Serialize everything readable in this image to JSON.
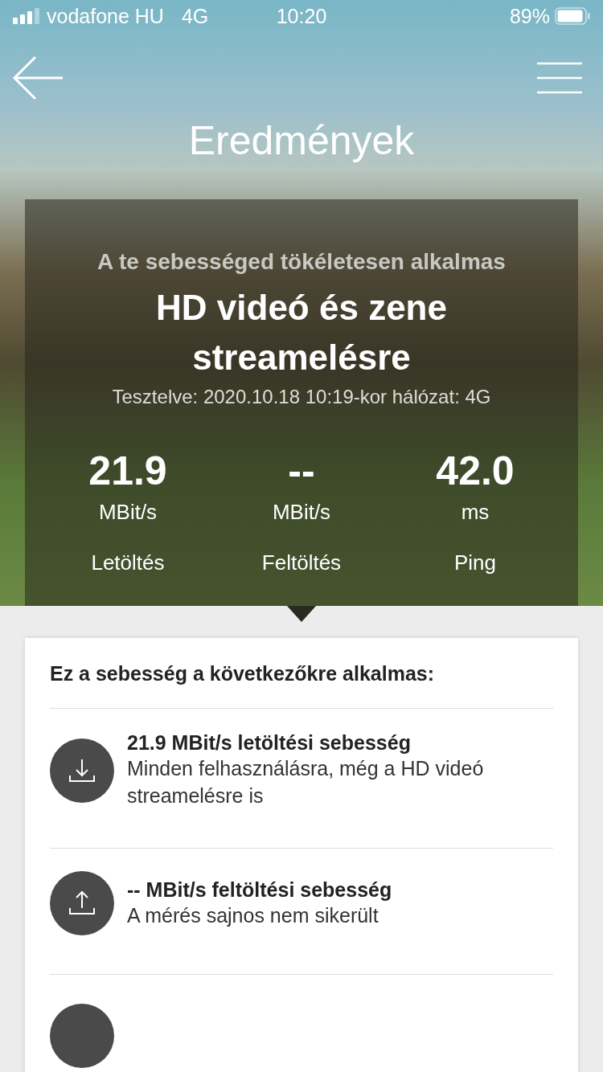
{
  "status_bar": {
    "carrier": "vodafone HU",
    "network": "4G",
    "time": "10:20",
    "battery": "89%"
  },
  "header": {
    "title": "Eredmények"
  },
  "result": {
    "subtitle": "A te sebességed tökéletesen alkalmas",
    "headline": "HD videó és zene streamelésre",
    "tested": "Tesztelve: 2020.10.18 10:19-kor hálózat: 4G",
    "stats": [
      {
        "value": "21.9",
        "unit": "MBit/s",
        "label": "Letöltés"
      },
      {
        "value": "--",
        "unit": "MBit/s",
        "label": "Feltöltés"
      },
      {
        "value": "42.0",
        "unit": "ms",
        "label": "Ping"
      }
    ]
  },
  "suitability": {
    "heading": "Ez a sebesség a következőkre alkalmas:",
    "items": [
      {
        "kind": "download",
        "title": "21.9 MBit/s letöltési sebesség",
        "description": "Minden felhasználásra, még a HD videó streamelésre is"
      },
      {
        "kind": "upload",
        "title": "-- MBit/s feltöltési sebesség",
        "description": "A mérés sajnos nem sikerült"
      },
      {
        "kind": "partial"
      }
    ]
  }
}
